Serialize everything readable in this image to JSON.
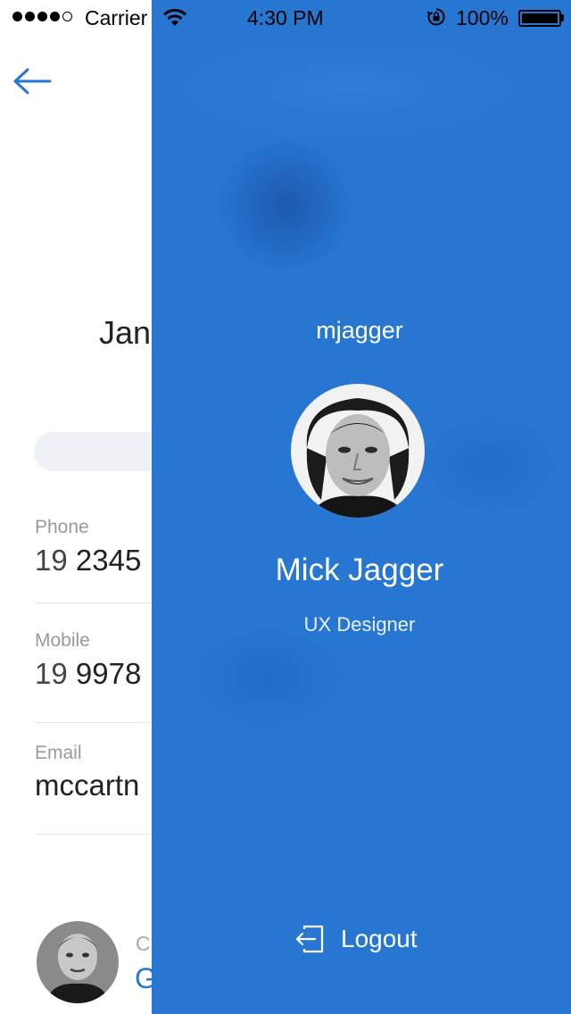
{
  "status_bar": {
    "carrier": "Carrier",
    "time": "4:30 PM",
    "battery": "100%",
    "signal_icon": "signal-dots-icon",
    "wifi_icon": "wifi-icon",
    "lock_icon": "orientation-lock-icon",
    "battery_icon": "battery-icon"
  },
  "contact": {
    "back_icon": "arrow-left-icon",
    "name_partial": "Jan",
    "phone": {
      "label": "Phone",
      "prefix": "19",
      "value": "2345"
    },
    "mobile": {
      "label": "Mobile",
      "prefix": "19",
      "value": "9978"
    },
    "email": {
      "label": "Email",
      "value": "mccartn"
    },
    "manager": {
      "role_partial": "C",
      "name_partial": "G"
    }
  },
  "drawer": {
    "username": "mjagger",
    "full_name": "Mick Jagger",
    "title": "UX Designer",
    "logout_label": "Logout",
    "logout_icon": "logout-icon"
  },
  "colors": {
    "drawer_bg": "#2676d2",
    "accent": "#2577d0",
    "pill_bg": "#eef1f5"
  }
}
